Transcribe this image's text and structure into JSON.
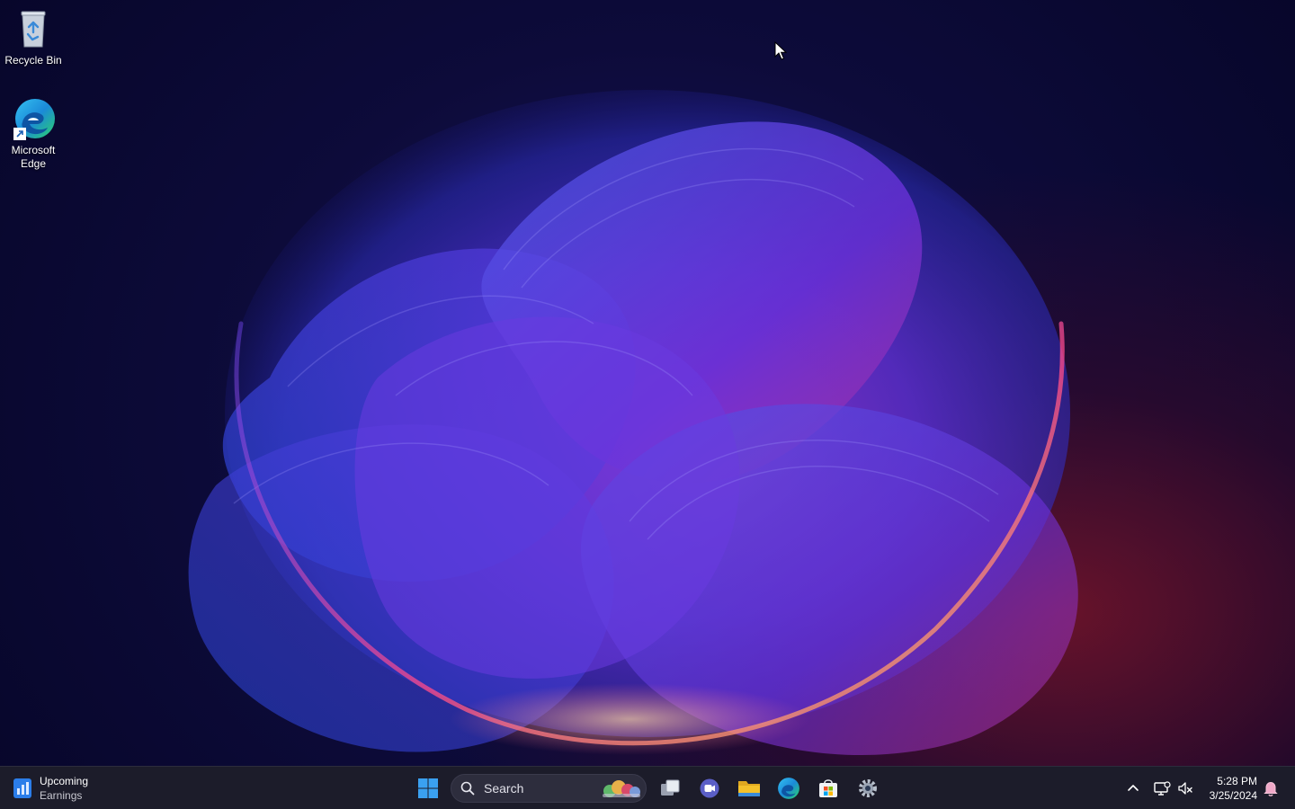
{
  "desktop": {
    "icons": [
      {
        "label": "Recycle Bin",
        "icon": "recycle-bin-icon"
      },
      {
        "label": "Microsoft Edge",
        "icon": "edge-icon"
      }
    ]
  },
  "taskbar": {
    "widget": {
      "title": "Upcoming",
      "subtitle": "Earnings",
      "icon": "stocks-widget-icon"
    },
    "search": {
      "placeholder": "Search"
    },
    "pinned": [
      {
        "name": "start",
        "icon": "windows-logo-icon"
      },
      {
        "name": "task-view",
        "icon": "task-view-icon"
      },
      {
        "name": "teams",
        "icon": "teams-chat-icon"
      },
      {
        "name": "file-explorer",
        "icon": "folder-icon"
      },
      {
        "name": "edge",
        "icon": "edge-icon"
      },
      {
        "name": "microsoft-store",
        "icon": "store-icon"
      },
      {
        "name": "settings",
        "icon": "gear-icon"
      }
    ],
    "tray": {
      "time": "5:28 PM",
      "date": "3/25/2024"
    }
  },
  "colors": {
    "taskbar_bg": "#1c1c2a",
    "windows_blue": "#3aa0f0",
    "folder_yellow": "#f4c12b",
    "accent_purple": "#5b5fc7"
  }
}
